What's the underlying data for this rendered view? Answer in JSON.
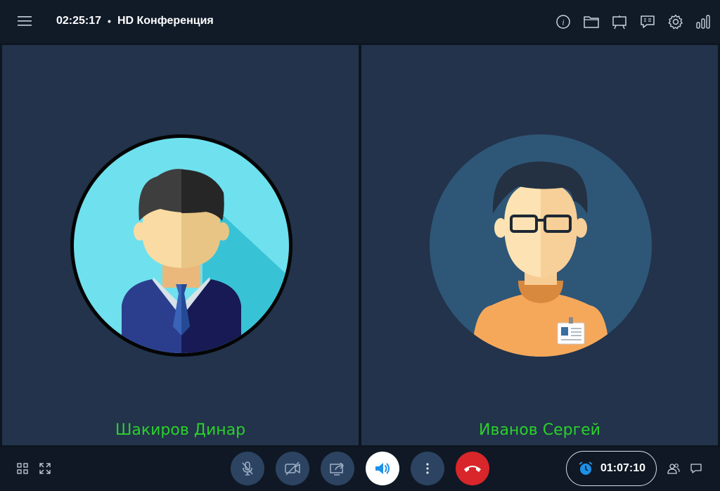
{
  "header": {
    "time": "02:25:17",
    "separator": "•",
    "conference_title": "HD Конференция",
    "icons": [
      "menu-icon",
      "info-icon",
      "folder-icon",
      "presentation-board-icon",
      "chat-board-icon",
      "gear-icon",
      "signal-bars-icon"
    ]
  },
  "participants": [
    {
      "name": "Шакиров Динар",
      "avatar": "man-in-suit-avatar"
    },
    {
      "name": "Иванов Сергей",
      "avatar": "man-with-glasses-avatar"
    }
  ],
  "controls": {
    "buttons": [
      "microphone-off-icon",
      "camera-off-icon",
      "screen-share-icon",
      "speaker-icon",
      "more-vertical-icon",
      "hang-up-icon"
    ],
    "left_icons": [
      "grid-layout-icon",
      "fullscreen-icon"
    ],
    "right_icons": [
      "participants-icon",
      "chat-icon"
    ]
  },
  "timer": {
    "value": "01:07:10",
    "icon": "alarm-clock-icon"
  },
  "colors": {
    "accent": "#1e90e8",
    "name_text": "#2ad12a",
    "tile_bg": "#22334b",
    "hangup": "#d8262a"
  }
}
